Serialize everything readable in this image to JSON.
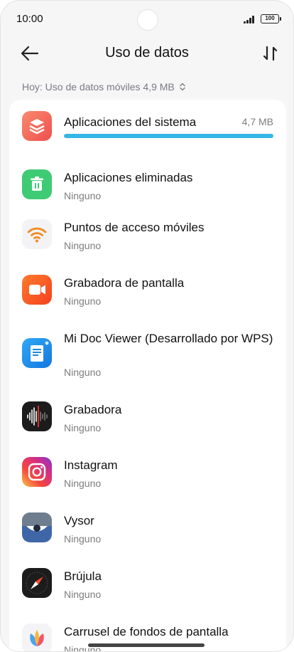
{
  "status": {
    "time": "10:00",
    "battery": "100"
  },
  "header": {
    "title": "Uso de datos"
  },
  "filter": {
    "label": "Hoy: Uso de datos móviles 4,9 MB"
  },
  "apps": [
    {
      "name": "Aplicaciones del sistema",
      "size": "4,7 MB",
      "usage_fraction": 1.0,
      "icon": "layers-icon",
      "color": "#f0695a"
    },
    {
      "name": "Aplicaciones eliminadas",
      "sub": "Ninguno",
      "icon": "trash-icon",
      "color": "#37c86e"
    },
    {
      "name": "Puntos de acceso móviles",
      "sub": "Ninguno",
      "icon": "wifi-hotspot-icon",
      "color": "#f38a25"
    },
    {
      "name": "Grabadora de pantalla",
      "sub": "Ninguno",
      "icon": "video-camera-icon",
      "color": "#f4511e"
    },
    {
      "name": "Mi Doc Viewer (Desarrollado por WPS)",
      "sub": "Ninguno",
      "icon": "document-icon",
      "color": "#1e88e5"
    },
    {
      "name": "Grabadora",
      "sub": "Ninguno",
      "icon": "waveform-icon",
      "color": "#1a1a1a"
    },
    {
      "name": "Instagram",
      "sub": "Ninguno",
      "icon": "instagram-icon",
      "color": "#e1306c"
    },
    {
      "name": "Vysor",
      "sub": "Ninguno",
      "icon": "eye-icon",
      "color": "#4a6fa0"
    },
    {
      "name": "Brújula",
      "sub": "Ninguno",
      "icon": "compass-icon",
      "color": "#1c1c1c"
    },
    {
      "name": "Carrusel de fondos de pantalla",
      "sub": "Ninguno",
      "icon": "leaf-icon",
      "color": "#ffffff"
    }
  ]
}
